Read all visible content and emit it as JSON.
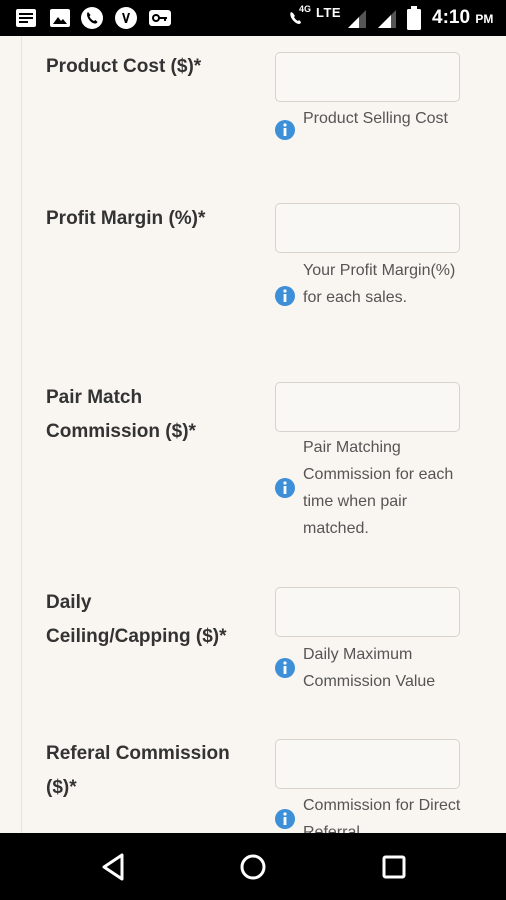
{
  "status_bar": {
    "network_type": "4G",
    "lte_label": "LTE",
    "time": "4:10",
    "ampm": "PM",
    "left_icons": [
      "message-icon",
      "image-icon",
      "phone-icon",
      "viber-icon",
      "vpn-key-icon"
    ],
    "right_icons": [
      "wifi-calling-icon",
      "signal-icon",
      "signal-icon",
      "battery-icon"
    ]
  },
  "form": {
    "fields": [
      {
        "label": "Product Cost ($)*",
        "value": "",
        "hint": "Product Selling Cost"
      },
      {
        "label": "Profit Margin (%)*",
        "value": "",
        "hint": "Your Profit Margin(%) for each sales."
      },
      {
        "label": "Pair Match Commission ($)*",
        "value": "",
        "hint": "Pair Matching Commission for each time when pair matched."
      },
      {
        "label": "Daily Ceiling/Capping ($)*",
        "value": "",
        "hint": "Daily Maximum Commission Value"
      },
      {
        "label": "Referal Commission ($)*",
        "value": "",
        "hint": "Commission for Direct Referral"
      }
    ]
  },
  "colors": {
    "page_background": "#f9f6f1",
    "info_icon": "#3d8fd7",
    "label_text": "#333333",
    "hint_text": "#555555"
  },
  "nav_bar": {
    "buttons": [
      "back-icon",
      "home-icon",
      "recents-icon"
    ]
  }
}
